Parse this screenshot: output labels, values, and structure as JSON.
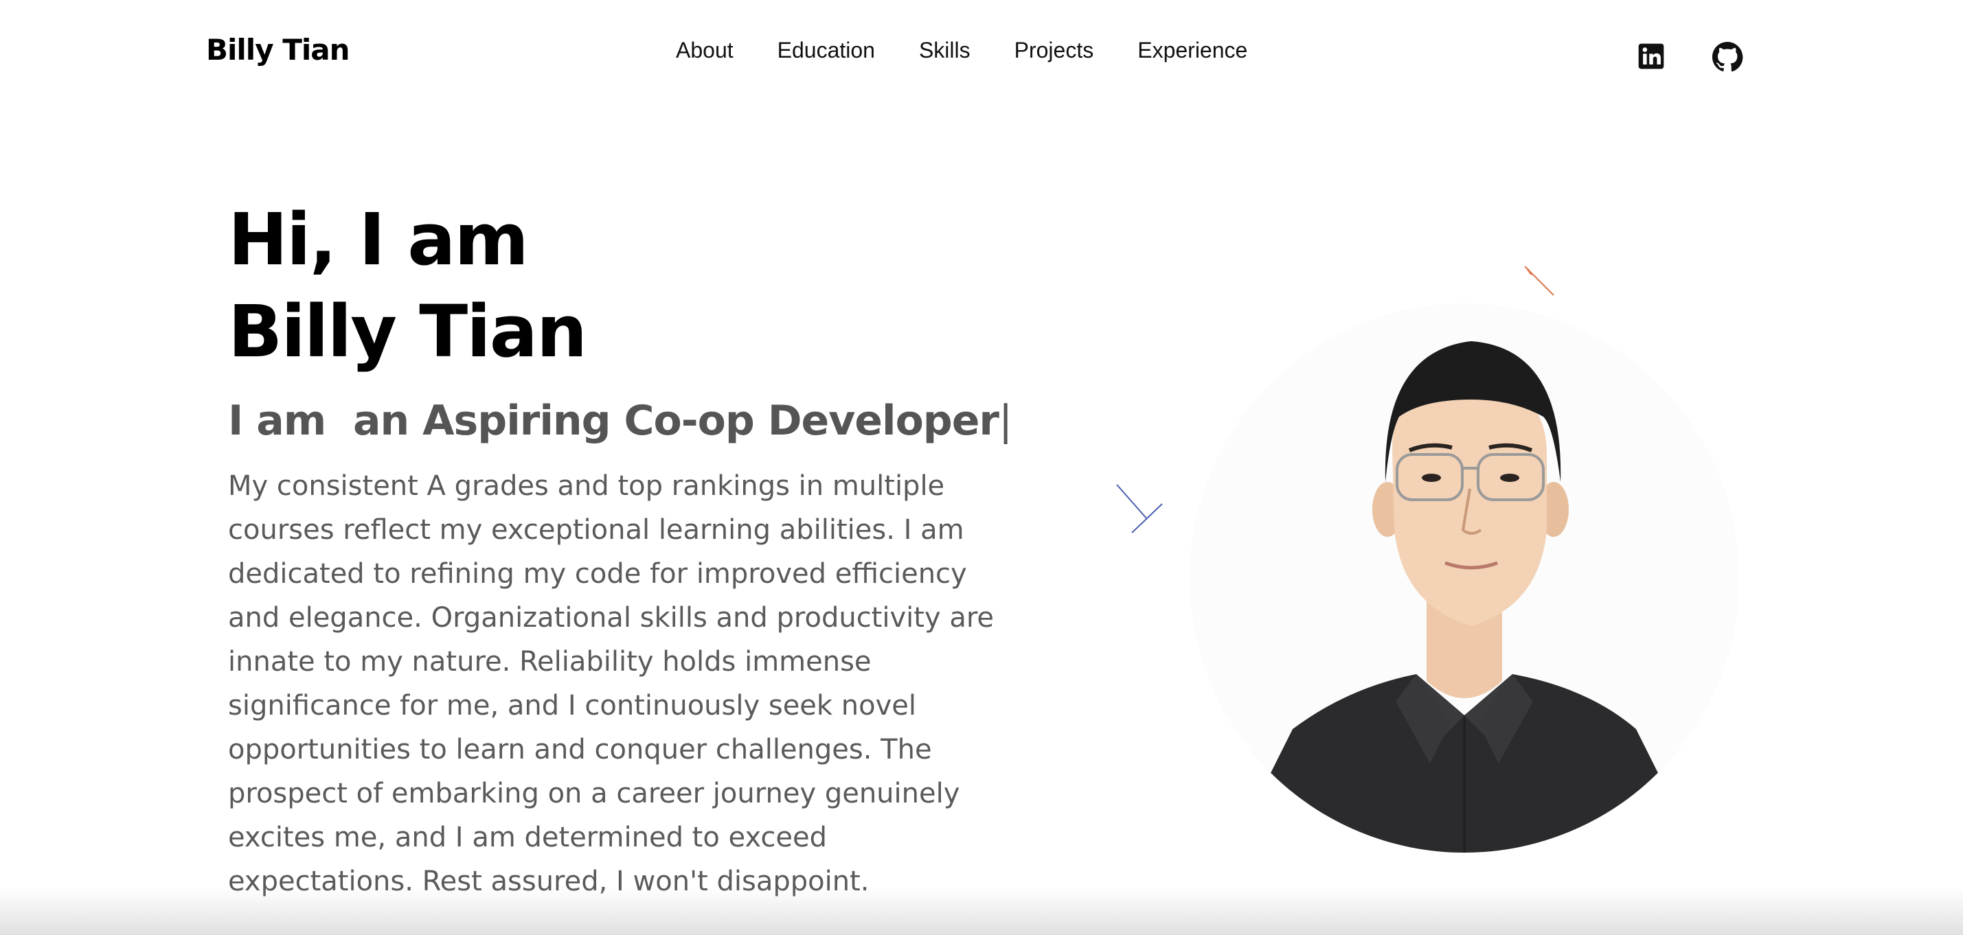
{
  "nav": {
    "brand": "Billy Tian",
    "links": [
      "About",
      "Education",
      "Skills",
      "Projects",
      "Experience"
    ],
    "social": [
      {
        "icon": "linkedin-icon"
      },
      {
        "icon": "github-icon"
      }
    ]
  },
  "hero": {
    "greeting_line1": "Hi, I am",
    "greeting_line2": "Billy Tian",
    "role_prefix": "I am",
    "role_text": "an Aspiring Co-op Developer",
    "caret": "|",
    "bio": "My consistent A grades and top rankings in multiple courses reflect my exceptional learning abilities. I am dedicated to refining my code for improved efficiency and elegance. Organizational skills and productivity are innate to my nature. Reliability holds immense significance for me, and I continuously seek novel opportunities to learn and conquer challenges. The prospect of embarking on a career journey genuinely excites me, and I am determined to exceed expectations. Rest assured, I won't disappoint."
  },
  "colors": {
    "heading": "#000000",
    "role": "#555555",
    "body": "#5a5a5a",
    "spark_orange": "#e0774a",
    "spark_blue": "#4a5fb0"
  }
}
